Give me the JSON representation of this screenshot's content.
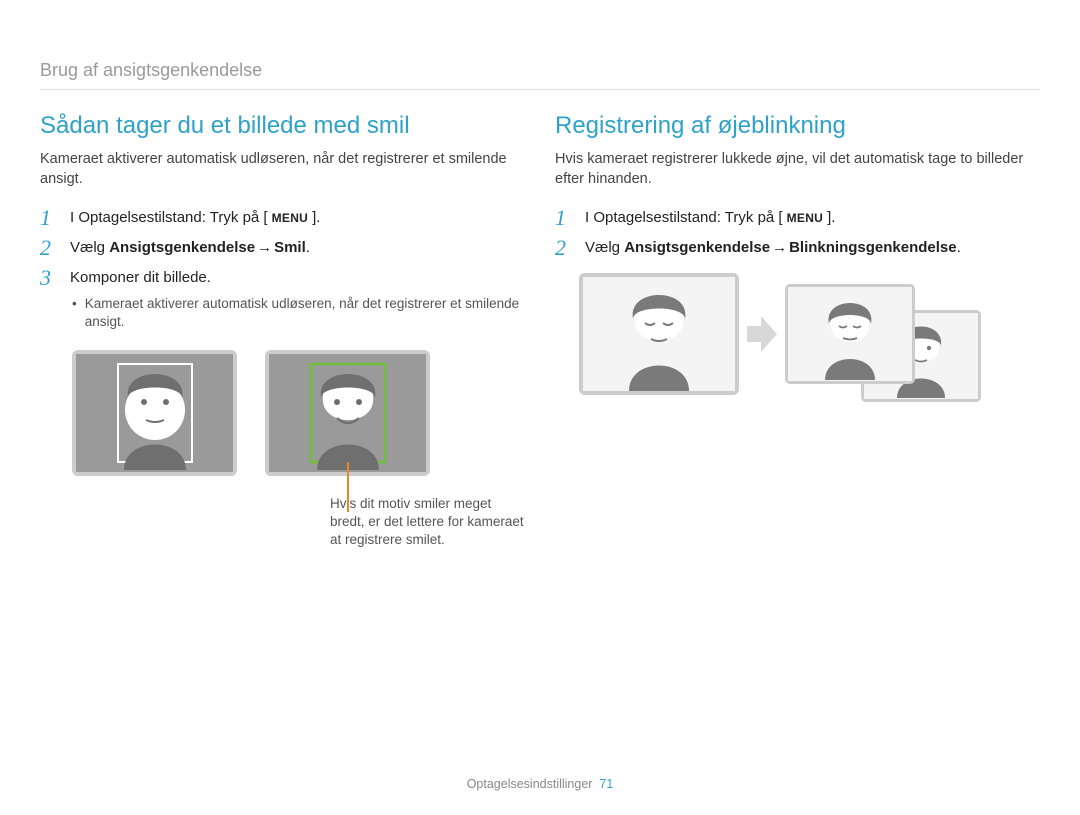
{
  "breadcrumb": "Brug af ansigtsgenkendelse",
  "left": {
    "heading": "Sådan tager du et billede med smil",
    "intro": "Kameraet aktiverer automatisk udløseren, når det registrerer et smilende ansigt.",
    "steps": {
      "s1": "I Optagelsestilstand: Tryk på [",
      "s1_after": "].",
      "s2_pre": "Vælg ",
      "s2_bold1": "Ansigtsgenkendelse",
      "s2_arrow": " → ",
      "s2_bold2": "Smil",
      "s2_post": ".",
      "s3": "Komponer dit billede.",
      "bullet": "Kameraet aktiverer automatisk udløseren, når det registrerer et smilende ansigt."
    },
    "tip": "Hvis dit motiv smiler meget bredt, er det lettere for kameraet at registrere smilet."
  },
  "right": {
    "heading": "Registrering af øjeblinkning",
    "intro": "Hvis kameraet registrerer lukkede øjne, vil det automatisk tage to billeder efter hinanden.",
    "steps": {
      "s1": "I Optagelsestilstand: Tryk på [",
      "s1_after": "].",
      "s2_pre": "Vælg ",
      "s2_bold1": "Ansigtsgenkendelse",
      "s2_arrow": " → ",
      "s2_bold2": "Blinkningsgenkendelse",
      "s2_post": "."
    }
  },
  "menu_label": "MENU",
  "footer_section": "Optagelsesindstillinger",
  "footer_page": "71"
}
